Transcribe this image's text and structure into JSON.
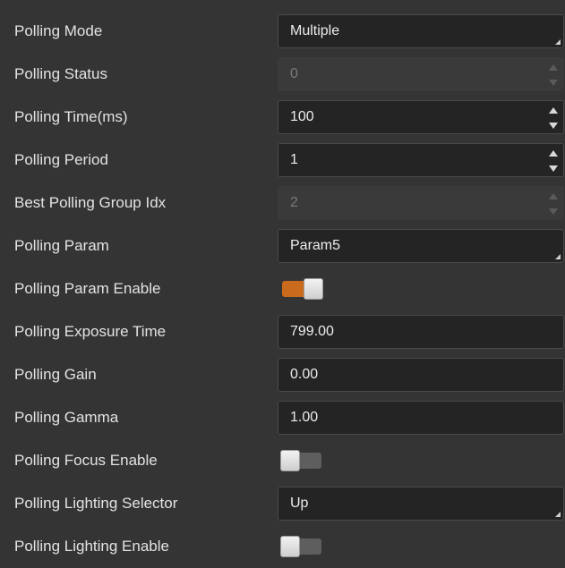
{
  "params": [
    {
      "label": "Polling Mode",
      "type": "combo",
      "value": "Multiple"
    },
    {
      "label": "Polling Status",
      "type": "spin-disabled",
      "value": "0"
    },
    {
      "label": "Polling Time(ms)",
      "type": "spin",
      "value": "100"
    },
    {
      "label": "Polling Period",
      "type": "spin",
      "value": "1"
    },
    {
      "label": "Best Polling Group Idx",
      "type": "spin-disabled",
      "value": "2"
    },
    {
      "label": "Polling Param",
      "type": "combo",
      "value": "Param5"
    },
    {
      "label": "Polling Param Enable",
      "type": "toggle",
      "value": true
    },
    {
      "label": "Polling Exposure Time",
      "type": "text",
      "value": "799.00"
    },
    {
      "label": "Polling Gain",
      "type": "text",
      "value": "0.00"
    },
    {
      "label": "Polling Gamma",
      "type": "text",
      "value": "1.00"
    },
    {
      "label": "Polling Focus Enable",
      "type": "toggle",
      "value": false
    },
    {
      "label": "Polling Lighting Selector",
      "type": "combo",
      "value": "Up"
    },
    {
      "label": "Polling Lighting Enable",
      "type": "toggle",
      "value": false
    }
  ],
  "colors": {
    "toggle_on": "#c96a1c",
    "background": "#343434",
    "field": "#242424"
  }
}
